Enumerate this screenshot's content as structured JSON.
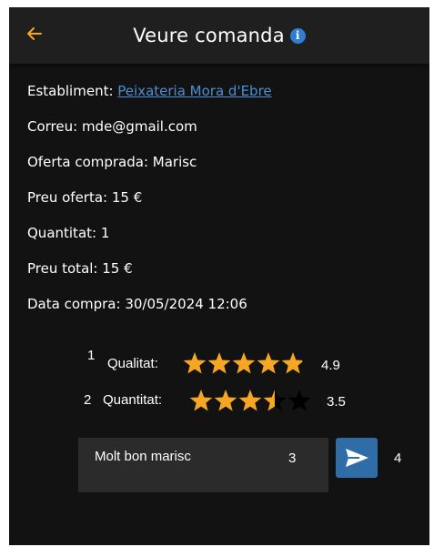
{
  "header": {
    "title": "Veure comanda",
    "back_icon": "arrow-left-icon",
    "info_icon": "info-icon"
  },
  "details": {
    "establiment_label": "Establiment:",
    "establiment_link": "Peixateria Mora d'Ebre",
    "correu": "Correu: mde@gmail.com",
    "oferta": "Oferta comprada: Marisc",
    "preu_oferta": "Preu oferta: 15 €",
    "quantitat": "Quantitat: 1",
    "preu_total": "Preu total: 15 €",
    "data_compra": "Data compra: 30/05/2024 12:06"
  },
  "ratings": [
    {
      "marker": "1",
      "label": "Qualitat:",
      "value": "4.9",
      "stars": 4.9
    },
    {
      "marker": "2",
      "label": "Quantitat:",
      "value": "3.5",
      "stars": 3.5
    }
  ],
  "comment": {
    "text": "Molt bon marisc",
    "marker": "3"
  },
  "send": {
    "marker": "4",
    "icon": "send-icon"
  },
  "colors": {
    "background": "#121212",
    "appbar": "#1f1f1f",
    "accent": "#f5a623",
    "link": "#4a8fd6",
    "send": "#2f6da8",
    "star": "#f5a623"
  }
}
